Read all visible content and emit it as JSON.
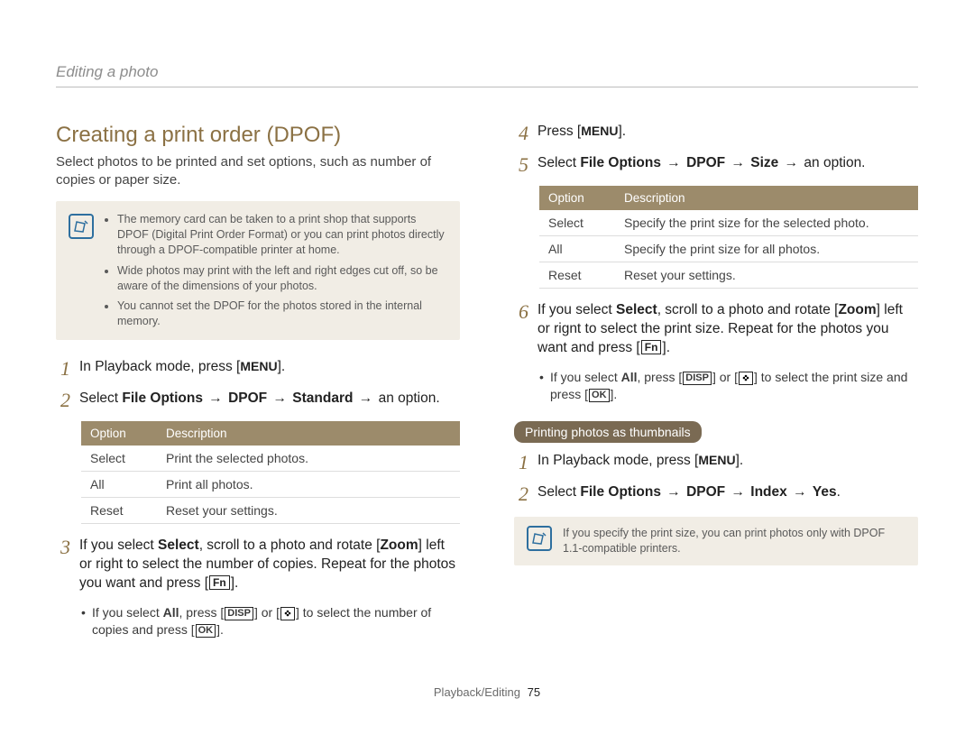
{
  "breadcrumb": "Editing a photo",
  "heading": "Creating a print order (DPOF)",
  "intro": "Select photos to be printed and set options, such as number of copies or paper size.",
  "note1": {
    "items": [
      "The memory card can be taken to a print shop that supports DPOF (Digital Print Order Format) or you can print photos directly through a DPOF-compatible printer at home.",
      "Wide photos may print with the left and right edges cut off, so be aware of the dimensions of your photos.",
      "You cannot set the DPOF for the photos stored in the internal memory."
    ]
  },
  "labels": {
    "menu": "MENU",
    "fn": "Fn",
    "disp": "DISP",
    "ok": "OK",
    "arrow": "→"
  },
  "left": {
    "step1_pre": "In Playback mode, press [",
    "step1_post": "].",
    "step2_pre": "Select ",
    "step2_b1": "File Options",
    "step2_b2": "DPOF",
    "step2_b3": "Standard",
    "step2_post": " an option.",
    "table_h1": "Option",
    "table_h2": "Description",
    "rows": [
      {
        "opt": "Select",
        "desc": "Print the selected photos."
      },
      {
        "opt": "All",
        "desc": "Print all photos."
      },
      {
        "opt": "Reset",
        "desc": "Reset your settings."
      }
    ],
    "step3_part1": "If you select ",
    "step3_b1": "Select",
    "step3_part2": ", scroll to a photo and rotate [",
    "step3_b2": "Zoom",
    "step3_part3": "] left or right to select the number of copies. Repeat for the photos you want and press [",
    "step3_part4": "].",
    "sub_a": "If you select ",
    "sub_b": "All",
    "sub_c": ", press [",
    "sub_d": "] or [",
    "sub_e": "] to select the number of copies and press [",
    "sub_f": "]."
  },
  "right": {
    "step4_pre": "Press [",
    "step4_post": "].",
    "step5_pre": "Select ",
    "step5_b1": "File Options",
    "step5_b2": "DPOF",
    "step5_b3": "Size",
    "step5_post": " an option.",
    "table_h1": "Option",
    "table_h2": "Description",
    "rows": [
      {
        "opt": "Select",
        "desc": "Specify the print size for the selected photo."
      },
      {
        "opt": "All",
        "desc": "Specify the print size for all photos."
      },
      {
        "opt": "Reset",
        "desc": "Reset your settings."
      }
    ],
    "step6_part1": "If you select ",
    "step6_b1": "Select",
    "step6_part2": ", scroll to a photo and rotate [",
    "step6_b2": "Zoom",
    "step6_part3": "] left or rignt to select the print size. Repeat for the photos you want and press [",
    "step6_part4": "].",
    "sub_a": "If you select ",
    "sub_b": "All",
    "sub_c": ", press [",
    "sub_d": "] or [",
    "sub_e": "] to select the print size and press [",
    "sub_f": "].",
    "pill": "Printing photos as thumbnails",
    "tstep1_pre": "In Playback mode, press [",
    "tstep1_post": "].",
    "tstep2_pre": "Select ",
    "tstep2_b1": "File Options",
    "tstep2_b2": "DPOF",
    "tstep2_b3": "Index",
    "tstep2_b4": "Yes",
    "tstep2_post": ".",
    "note2": "If you specify the print size, you can print photos only with DPOF 1.1-compatible printers."
  },
  "footer": {
    "section": "Playback/Editing",
    "page": "75"
  }
}
